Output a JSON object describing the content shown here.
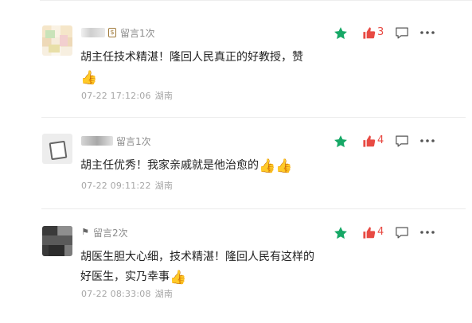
{
  "comments": [
    {
      "badge_icon": "money-bag-icon",
      "message_count": "留言1次",
      "text": "胡主任技术精湛！隆回人民真正的好教授，赞",
      "emoji": "👍",
      "time": "07-22 17:12:06",
      "location": "湖南",
      "likes": "3"
    },
    {
      "badge_icon": "none",
      "message_count": "留言1次",
      "text": "胡主任优秀！我家亲戚就是他治愈的",
      "emoji": "👍👍",
      "time": "07-22 09:11:22",
      "location": "湖南",
      "likes": "4"
    },
    {
      "badge_icon": "flag-icon",
      "message_count": "留言2次",
      "text": "胡医生胆大心细，技术精湛！隆回人民有这样的好医生，实乃幸事",
      "emoji": "👍",
      "time": "07-22 08:33:08",
      "location": "湖南",
      "likes": "4"
    }
  ],
  "colors": {
    "star": "#16a866",
    "like": "#e84a43",
    "muted": "#9a9a9a"
  }
}
